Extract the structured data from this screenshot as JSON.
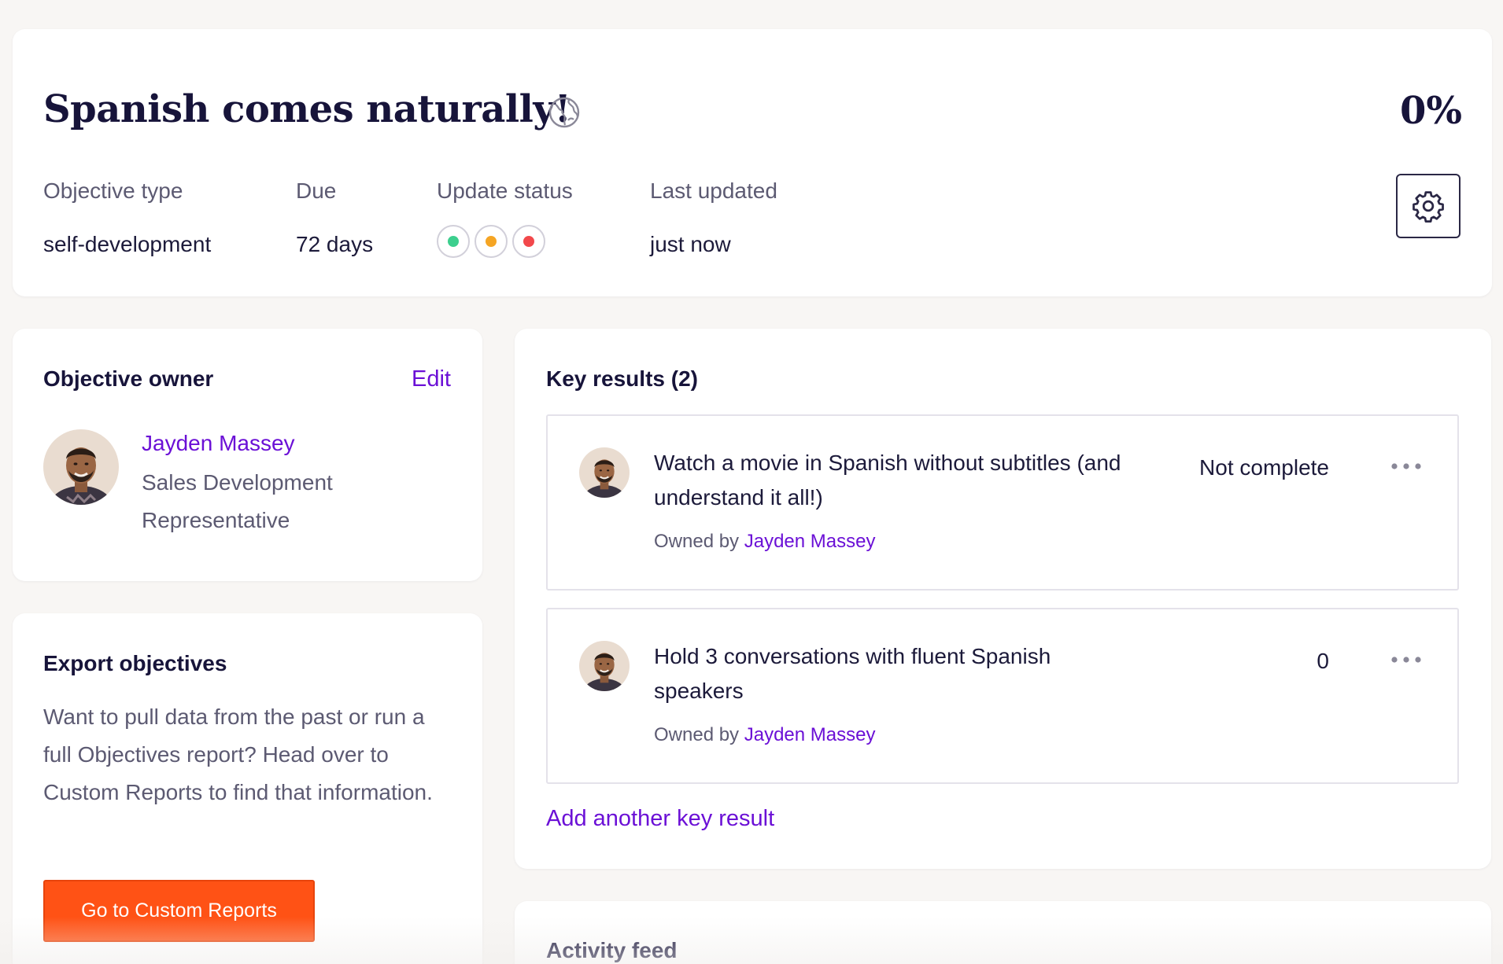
{
  "objective": {
    "title": "Spanish comes naturally!",
    "visibility_icon": "globe-icon",
    "progress": "0%",
    "progress_value": 0
  },
  "meta": {
    "type_label": "Objective type",
    "type_value": "self-development",
    "due_label": "Due",
    "due_value": "72 days",
    "status_label": "Update status",
    "status_options": [
      {
        "name": "on-track",
        "color": "#3ccf8e"
      },
      {
        "name": "at-risk",
        "color": "#f5a524"
      },
      {
        "name": "off-track",
        "color": "#f2484b"
      }
    ],
    "updated_label": "Last updated",
    "updated_value": "just now",
    "settings_icon": "gear-icon"
  },
  "owner_card": {
    "heading": "Objective owner",
    "edit_label": "Edit",
    "name": "Jayden Massey",
    "role": "Sales Development Representative"
  },
  "export_card": {
    "heading": "Export objectives",
    "body": "Want to pull data from the past or run a full Objectives report? Head over to Custom Reports to find that information.",
    "button_label": "Go to Custom Reports"
  },
  "key_results": {
    "heading": "Key results (2)",
    "owned_by_label": "Owned by",
    "items": [
      {
        "title": "Watch a movie in Spanish without subtitles (and understand it all!)",
        "owner": "Jayden Massey",
        "status": "Not complete"
      },
      {
        "title": "Hold 3 conversations with fluent Spanish speakers",
        "owner": "Jayden Massey",
        "status": "0"
      }
    ],
    "add_label": "Add another key result",
    "menu_icon": "more-horizontal-icon"
  },
  "activity": {
    "heading": "Activity feed"
  },
  "colors": {
    "accent": "#6b10d6",
    "cta": "#ff5215",
    "text_dark": "#17143a",
    "text_muted": "#5c5a72",
    "background": "#f8f6f4"
  }
}
